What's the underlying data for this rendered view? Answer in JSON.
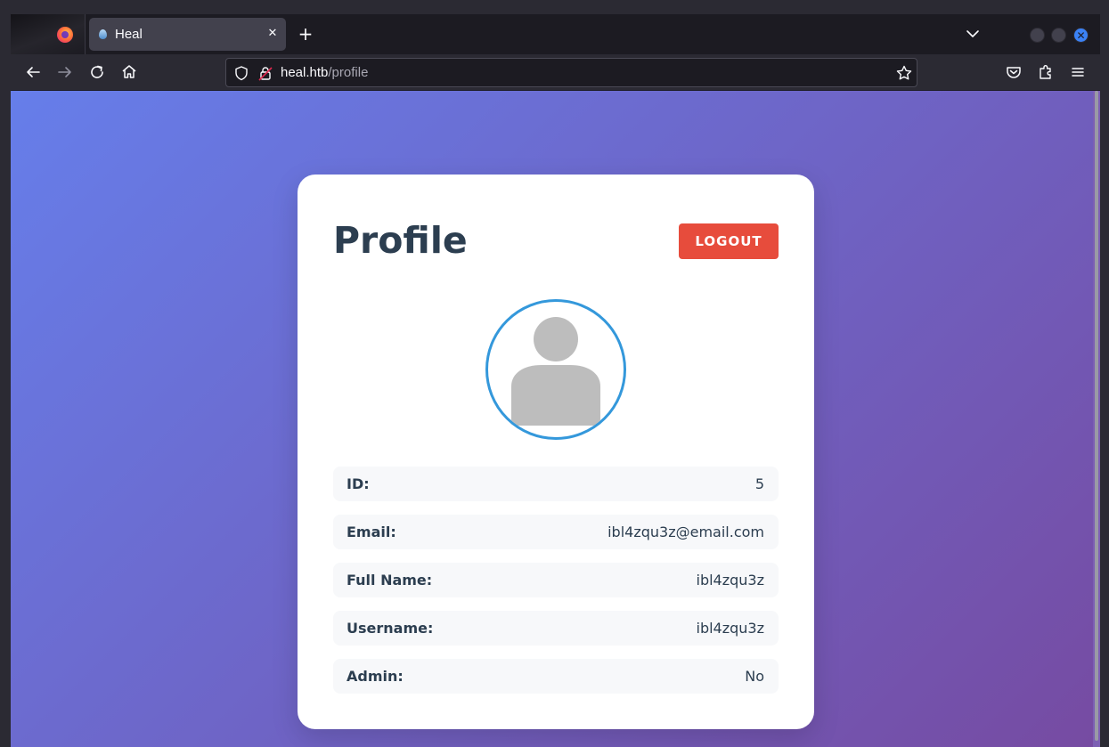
{
  "browser": {
    "tab_title": "Heal",
    "url_domain": "heal.htb",
    "url_path": "/profile",
    "accent_color": "#3b82f6"
  },
  "page": {
    "title": "Profile",
    "logout_label": "LOGOUT",
    "logout_color": "#e74c3c",
    "avatar_border_color": "#3498db",
    "fields": [
      {
        "label": "ID:",
        "value": "5"
      },
      {
        "label": "Email:",
        "value": "ibl4zqu3z@email.com"
      },
      {
        "label": "Full Name:",
        "value": "ibl4zqu3z"
      },
      {
        "label": "Username:",
        "value": "ibl4zqu3z"
      },
      {
        "label": "Admin:",
        "value": "No"
      }
    ]
  },
  "icons": [
    "firefox-logo-icon",
    "tab-favicon-icon",
    "close-icon",
    "plus-icon",
    "chevron-down-icon",
    "back-icon",
    "forward-icon",
    "reload-icon",
    "home-icon",
    "shield-icon",
    "lock-icon",
    "star-icon",
    "pocket-icon",
    "extensions-icon",
    "menu-icon",
    "user-avatar-icon"
  ]
}
